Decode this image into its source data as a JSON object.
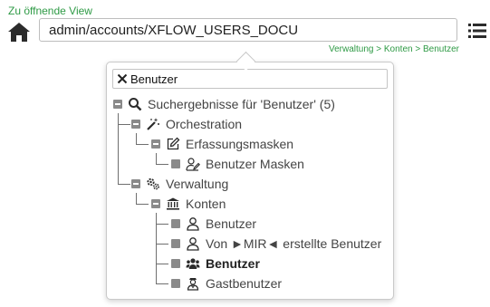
{
  "header": {
    "view_label": "Zu öffnende View",
    "url_value": "admin/accounts/XFLOW_USERS_DOCU",
    "breadcrumb": "Verwaltung > Konten > Benutzer"
  },
  "colors": {
    "accent": "#2e9a45",
    "icon": "#2b2b2b",
    "tree_box": "#8a8a8a"
  },
  "popup": {
    "search_value": "Benutzer",
    "tree": [
      {
        "label": "Suchergebnisse für 'Benutzer' (5)",
        "icon": "search-icon",
        "toggle": "expanded"
      },
      {
        "label": "Orchestration",
        "icon": "magic-wand-icon",
        "toggle": "expanded"
      },
      {
        "label": "Erfassungsmasken",
        "icon": "edit-icon",
        "toggle": "expanded"
      },
      {
        "label": "Benutzer Masken",
        "icon": "user-pen-icon",
        "toggle": "leaf"
      },
      {
        "label": "Verwaltung",
        "icon": "gears-icon",
        "toggle": "expanded"
      },
      {
        "label": "Konten",
        "icon": "bank-icon",
        "toggle": "expanded"
      },
      {
        "label": "Benutzer",
        "icon": "user-icon",
        "toggle": "leaf"
      },
      {
        "label": "Von ►MIR◄ erstellte Benutzer",
        "icon": "user-icon",
        "toggle": "leaf"
      },
      {
        "label": "Benutzer",
        "icon": "users-icon",
        "toggle": "leaf",
        "bold": true
      },
      {
        "label": "Gastbenutzer",
        "icon": "guest-user-icon",
        "toggle": "leaf"
      }
    ]
  }
}
